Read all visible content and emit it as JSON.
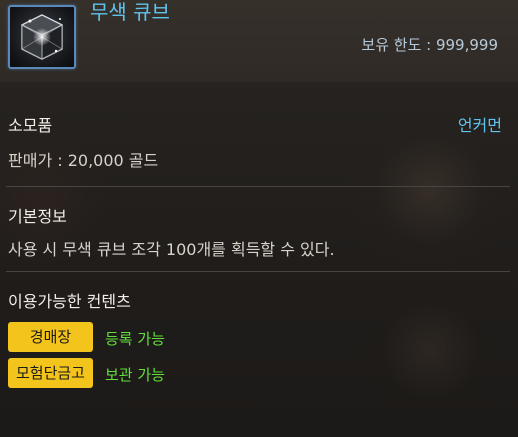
{
  "item": {
    "name": "무색 큐브",
    "possession_limit": "보유 한도 : 999,999",
    "icon": "colorless-cube-icon",
    "border_color": "#5a88b8"
  },
  "category": {
    "type_label": "소모품",
    "rarity_label": "언커먼",
    "rarity_color": "#5fc3ee",
    "sell_price": "판매가 : 20,000 골드"
  },
  "basic_info": {
    "title": "기본정보",
    "description": "사용 시 무색 큐브 조각 100개를 획득할 수 있다."
  },
  "available_content": {
    "title": "이용가능한 컨텐츠",
    "items": [
      {
        "tag": "경매장",
        "status": "등록 가능"
      },
      {
        "tag": "모험단금고",
        "status": "보관 가능"
      }
    ],
    "tag_color": "#f3c41b",
    "status_color": "#63df3a"
  }
}
